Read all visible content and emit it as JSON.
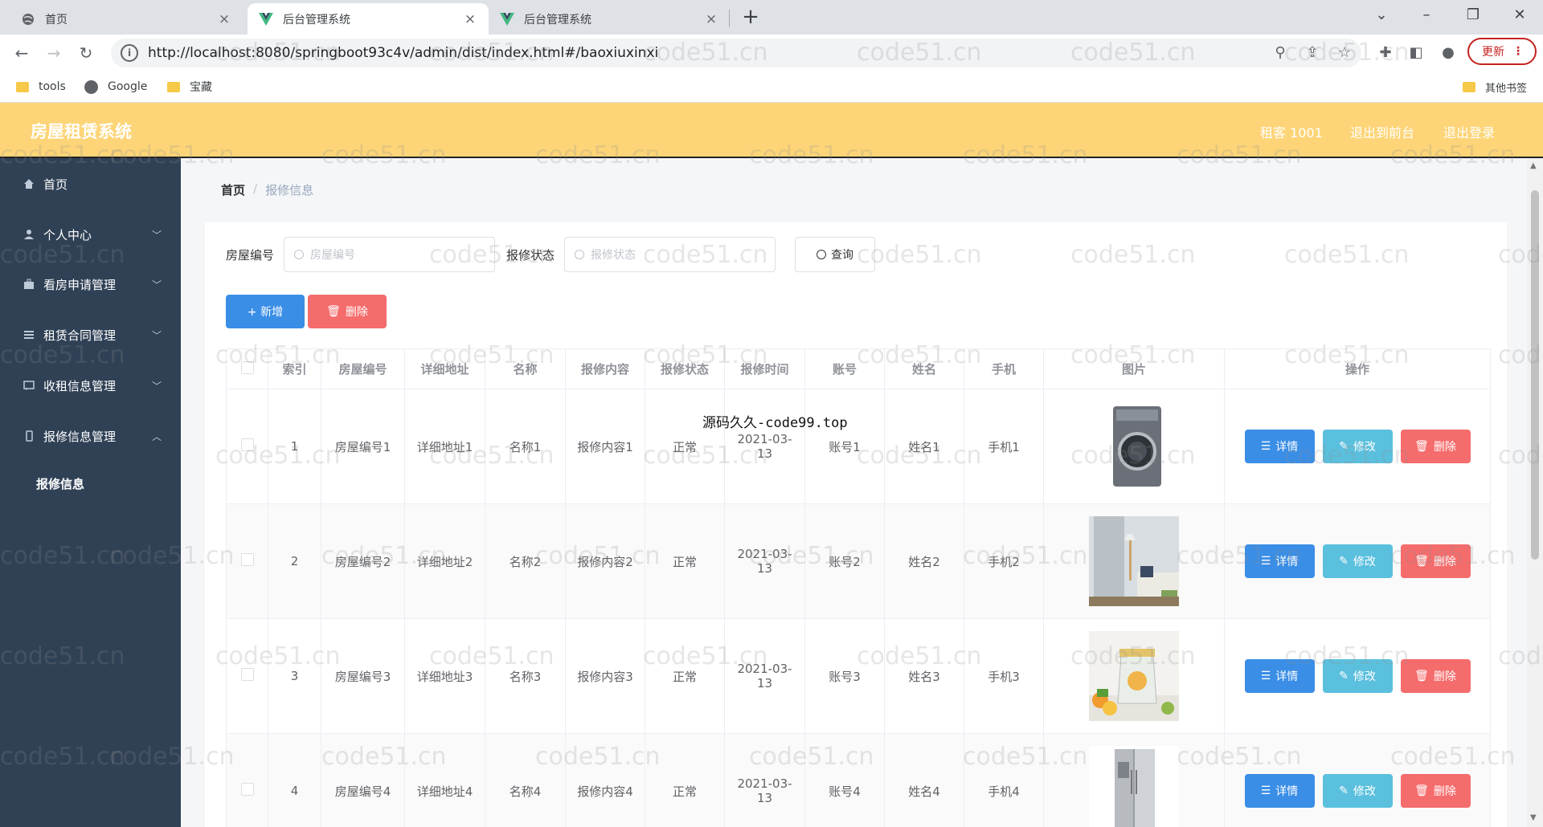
{
  "browser": {
    "tabs": [
      {
        "label": "首页"
      },
      {
        "label": "后台管理系统"
      },
      {
        "label": "后台管理系统"
      }
    ],
    "url": "http://localhost:8080/springboot93c4v/admin/dist/index.html#/baoxiuxinxi",
    "update_label": "更新",
    "bookmarks": [
      {
        "label": "tools"
      },
      {
        "label": "Google"
      },
      {
        "label": "宝藏"
      }
    ],
    "other_bookmarks": "其他书签"
  },
  "app": {
    "title": "房屋租赁系统",
    "user": "租客 1001",
    "back_front": "退出到前台",
    "logout": "退出登录"
  },
  "sidebar": {
    "items": [
      {
        "label": "首页",
        "icon": "home-icon"
      },
      {
        "label": "个人中心",
        "icon": "user-icon"
      },
      {
        "label": "看房申请管理",
        "icon": "briefcase-icon"
      },
      {
        "label": "租赁合同管理",
        "icon": "list-icon"
      },
      {
        "label": "收租信息管理",
        "icon": "message-icon"
      },
      {
        "label": "报修信息管理",
        "icon": "phone-icon"
      }
    ],
    "sub_item": "报修信息"
  },
  "breadcrumb": {
    "home": "首页",
    "sep": "/",
    "current": "报修信息"
  },
  "search": {
    "house_label": "房屋编号",
    "house_placeholder": "房屋编号",
    "status_label": "报修状态",
    "status_placeholder": "报修状态",
    "query_label": "查询"
  },
  "actions": {
    "add": "+ 新增",
    "delete": "删除"
  },
  "table": {
    "headers": [
      "索引",
      "房屋编号",
      "详细地址",
      "名称",
      "报修内容",
      "报修状态",
      "报修时间",
      "账号",
      "姓名",
      "手机",
      "图片",
      "操作"
    ],
    "rows": [
      {
        "index": "1",
        "house": "房屋编号1",
        "address": "详细地址1",
        "name": "名称1",
        "content": "报修内容1",
        "status": "正常",
        "time": "2021-03-13",
        "account": "账号1",
        "person": "姓名1",
        "phone": "手机1",
        "image": "washing-machine"
      },
      {
        "index": "2",
        "house": "房屋编号2",
        "address": "详细地址2",
        "name": "名称2",
        "content": "报修内容2",
        "status": "正常",
        "time": "2021-03-13",
        "account": "账号2",
        "person": "姓名2",
        "phone": "手机2",
        "image": "room-interior"
      },
      {
        "index": "3",
        "house": "房屋编号3",
        "address": "详细地址3",
        "name": "名称3",
        "content": "报修内容3",
        "status": "正常",
        "time": "2021-03-13",
        "account": "账号3",
        "person": "姓名3",
        "phone": "手机3",
        "image": "kettle"
      },
      {
        "index": "4",
        "house": "房屋编号4",
        "address": "详细地址4",
        "name": "名称4",
        "content": "报修内容4",
        "status": "正常",
        "time": "2021-03-13",
        "account": "账号4",
        "person": "姓名4",
        "phone": "手机4",
        "image": "refrigerator"
      }
    ],
    "ops": {
      "detail": "详情",
      "edit": "修改",
      "delete": "删除"
    }
  },
  "overlay_text": "源码久久-code99.top",
  "watermark": "code51.cn",
  "colors": {
    "header": "#fdd578",
    "sidebar": "#304156",
    "primary": "#3a8ee6",
    "info": "#5bc0de",
    "danger": "#f56c6c"
  }
}
